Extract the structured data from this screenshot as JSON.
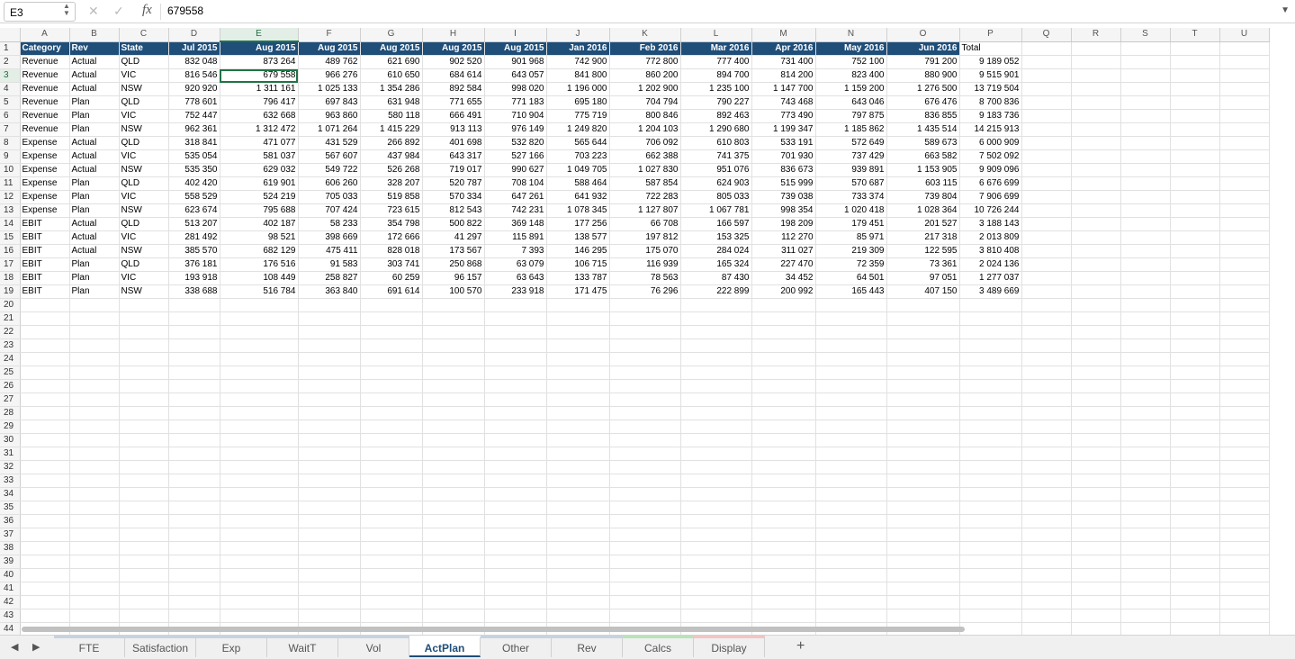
{
  "formula_bar": {
    "cell_ref": "E3",
    "formula": "679558",
    "cancel_icon": "✕",
    "confirm_icon": "✓",
    "fx_label": "fx"
  },
  "active_cell": {
    "row": 3,
    "col": "E"
  },
  "colors": {
    "header_fill": "#1f4e79",
    "header_text": "#ffffff",
    "selection": "#217346"
  },
  "columns": [
    "A",
    "B",
    "C",
    "D",
    "E",
    "F",
    "G",
    "H",
    "I",
    "J",
    "K",
    "L",
    "M",
    "N",
    "O",
    "P",
    "Q",
    "R",
    "S",
    "T",
    "U"
  ],
  "header_row": [
    "Category",
    "Rev",
    "State",
    "Jul 2015",
    "Aug 2015",
    "Aug 2015",
    "Aug 2015",
    "Aug 2015",
    "Aug 2015",
    "Jan 2016",
    "Feb 2016",
    "Mar 2016",
    "Apr 2016",
    "May 2016",
    "Jun 2016",
    "Total"
  ],
  "rows": [
    [
      "Revenue",
      "Actual",
      "QLD",
      "832 048",
      "873 264",
      "489 762",
      "621 690",
      "902 520",
      "901 968",
      "742 900",
      "772 800",
      "777 400",
      "731 400",
      "752 100",
      "791 200",
      "9 189 052"
    ],
    [
      "Revenue",
      "Actual",
      "VIC",
      "816 546",
      "679 558",
      "966 276",
      "610 650",
      "684 614",
      "643 057",
      "841 800",
      "860 200",
      "894 700",
      "814 200",
      "823 400",
      "880 900",
      "9 515 901"
    ],
    [
      "Revenue",
      "Actual",
      "NSW",
      "920 920",
      "1 311 161",
      "1 025 133",
      "1 354 286",
      "892 584",
      "998 020",
      "1 196 000",
      "1 202 900",
      "1 235 100",
      "1 147 700",
      "1 159 200",
      "1 276 500",
      "13 719 504"
    ],
    [
      "Revenue",
      "Plan",
      "QLD",
      "778 601",
      "796 417",
      "697 843",
      "631 948",
      "771 655",
      "771 183",
      "695 180",
      "704 794",
      "790 227",
      "743 468",
      "643 046",
      "676 476",
      "8 700 836"
    ],
    [
      "Revenue",
      "Plan",
      "VIC",
      "752 447",
      "632 668",
      "963 860",
      "580 118",
      "666 491",
      "710 904",
      "775 719",
      "800 846",
      "892 463",
      "773 490",
      "797 875",
      "836 855",
      "9 183 736"
    ],
    [
      "Revenue",
      "Plan",
      "NSW",
      "962 361",
      "1 312 472",
      "1 071 264",
      "1 415 229",
      "913 113",
      "976 149",
      "1 249 820",
      "1 204 103",
      "1 290 680",
      "1 199 347",
      "1 185 862",
      "1 435 514",
      "14 215 913"
    ],
    [
      "Expense",
      "Actual",
      "QLD",
      "318 841",
      "471 077",
      "431 529",
      "266 892",
      "401 698",
      "532 820",
      "565 644",
      "706 092",
      "610 803",
      "533 191",
      "572 649",
      "589 673",
      "6 000 909"
    ],
    [
      "Expense",
      "Actual",
      "VIC",
      "535 054",
      "581 037",
      "567 607",
      "437 984",
      "643 317",
      "527 166",
      "703 223",
      "662 388",
      "741 375",
      "701 930",
      "737 429",
      "663 582",
      "7 502 092"
    ],
    [
      "Expense",
      "Actual",
      "NSW",
      "535 350",
      "629 032",
      "549 722",
      "526 268",
      "719 017",
      "990 627",
      "1 049 705",
      "1 027 830",
      "951 076",
      "836 673",
      "939 891",
      "1 153 905",
      "9 909 096"
    ],
    [
      "Expense",
      "Plan",
      "QLD",
      "402 420",
      "619 901",
      "606 260",
      "328 207",
      "520 787",
      "708 104",
      "588 464",
      "587 854",
      "624 903",
      "515 999",
      "570 687",
      "603 115",
      "6 676 699"
    ],
    [
      "Expense",
      "Plan",
      "VIC",
      "558 529",
      "524 219",
      "705 033",
      "519 858",
      "570 334",
      "647 261",
      "641 932",
      "722 283",
      "805 033",
      "739 038",
      "733 374",
      "739 804",
      "7 906 699"
    ],
    [
      "Expense",
      "Plan",
      "NSW",
      "623 674",
      "795 688",
      "707 424",
      "723 615",
      "812 543",
      "742 231",
      "1 078 345",
      "1 127 807",
      "1 067 781",
      "998 354",
      "1 020 418",
      "1 028 364",
      "10 726 244"
    ],
    [
      "EBIT",
      "Actual",
      "QLD",
      "513 207",
      "402 187",
      "58 233",
      "354 798",
      "500 822",
      "369 148",
      "177 256",
      "66 708",
      "166 597",
      "198 209",
      "179 451",
      "201 527",
      "3 188 143"
    ],
    [
      "EBIT",
      "Actual",
      "VIC",
      "281 492",
      "98 521",
      "398 669",
      "172 666",
      "41 297",
      "115 891",
      "138 577",
      "197 812",
      "153 325",
      "112 270",
      "85 971",
      "217 318",
      "2 013 809"
    ],
    [
      "EBIT",
      "Actual",
      "NSW",
      "385 570",
      "682 129",
      "475 411",
      "828 018",
      "173 567",
      "7 393",
      "146 295",
      "175 070",
      "284 024",
      "311 027",
      "219 309",
      "122 595",
      "3 810 408"
    ],
    [
      "EBIT",
      "Plan",
      "QLD",
      "376 181",
      "176 516",
      "91 583",
      "303 741",
      "250 868",
      "63 079",
      "106 715",
      "116 939",
      "165 324",
      "227 470",
      "72 359",
      "73 361",
      "2 024 136"
    ],
    [
      "EBIT",
      "Plan",
      "VIC",
      "193 918",
      "108 449",
      "258 827",
      "60 259",
      "96 157",
      "63 643",
      "133 787",
      "78 563",
      "87 430",
      "34 452",
      "64 501",
      "97 051",
      "1 277 037"
    ],
    [
      "EBIT",
      "Plan",
      "NSW",
      "338 688",
      "516 784",
      "363 840",
      "691 614",
      "100 570",
      "233 918",
      "171 475",
      "76 296",
      "222 899",
      "200 992",
      "165 443",
      "407 150",
      "3 489 669"
    ]
  ],
  "total_rows": 44,
  "sheet_tabs": [
    {
      "label": "FTE"
    },
    {
      "label": "Satisfaction"
    },
    {
      "label": "Exp"
    },
    {
      "label": "WaitT"
    },
    {
      "label": "Vol"
    },
    {
      "label": "ActPlan",
      "active": true
    },
    {
      "label": "Other"
    },
    {
      "label": "Rev"
    },
    {
      "label": "Calcs",
      "color": "green"
    },
    {
      "label": "Display",
      "color": "pink"
    }
  ],
  "tab_nav": {
    "prev": "◀",
    "next": "▶",
    "add": "+"
  }
}
